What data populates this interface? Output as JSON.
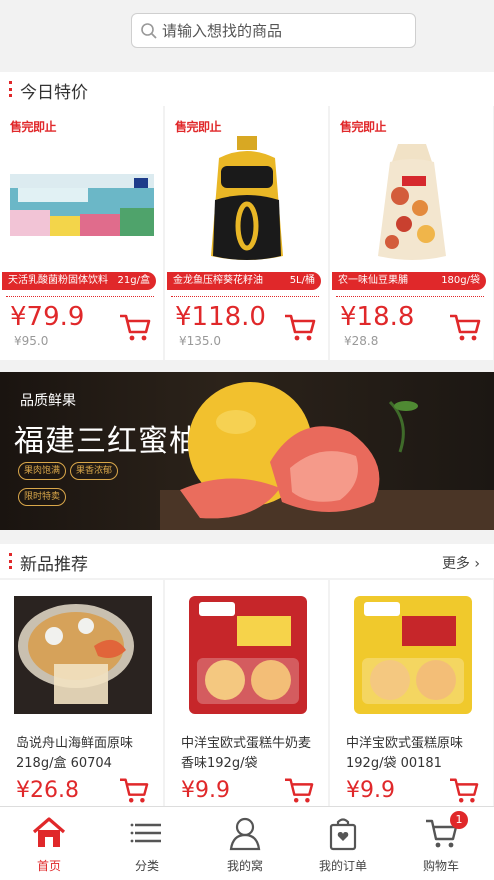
{
  "search": {
    "placeholder": "请输入想找的商品",
    "icon": "search-icon"
  },
  "deals_section": {
    "title": "今日特价"
  },
  "deals": [
    {
      "tag": "售完即止",
      "name": "天活乳酸菌粉固体饮料",
      "spec": "21g/盒",
      "price": "¥79.9",
      "old_price": "¥95.0"
    },
    {
      "tag": "售完即止",
      "name": "金龙鱼压榨葵花籽油",
      "spec": "5L/桶",
      "price": "¥118.0",
      "old_price": "¥135.0"
    },
    {
      "tag": "售完即止",
      "name": "农一味仙豆果脯",
      "spec": "180g/袋",
      "price": "¥18.8",
      "old_price": "¥28.8"
    }
  ],
  "banner": {
    "subtitle": "品质鲜果",
    "title": "福建三红蜜柚",
    "chips": [
      "果肉饱满",
      "果香浓郁",
      "限时特卖"
    ]
  },
  "new_section": {
    "title": "新品推荐",
    "more": "更多 ›"
  },
  "products": [
    {
      "name": "岛说舟山海鲜面原味218g/盒 60704",
      "price": "¥26.8"
    },
    {
      "name": "中洋宝欧式蛋糕牛奶麦香味192g/袋",
      "price": "¥9.9"
    },
    {
      "name": "中洋宝欧式蛋糕原味192g/袋 00181",
      "price": "¥9.9"
    }
  ],
  "tabbar": {
    "items": [
      {
        "label": "首页",
        "icon": "home-icon",
        "active": true
      },
      {
        "label": "分类",
        "icon": "list-icon"
      },
      {
        "label": "我的窝",
        "icon": "user-icon"
      },
      {
        "label": "我的订单",
        "icon": "order-bag-icon"
      },
      {
        "label": "购物车",
        "icon": "cart-icon",
        "badge": "1"
      }
    ]
  },
  "colors": {
    "accent": "#e0282a",
    "background": "#f2f2f2"
  }
}
